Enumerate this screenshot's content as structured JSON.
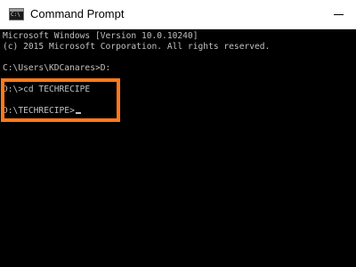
{
  "window": {
    "title": "Command Prompt",
    "icon_label": "C:\\",
    "icons": {
      "app": "command-prompt-icon",
      "minimize": "minimize-icon"
    }
  },
  "console": {
    "lines": [
      "Microsoft Windows [Version 10.0.10240]",
      "(c) 2015 Microsoft Corporation. All rights reserved.",
      "",
      "C:\\Users\\KDCanares>D:",
      "",
      "D:\\>cd TECHRECIPE",
      "",
      "D:\\TECHRECIPE>"
    ]
  },
  "colors": {
    "console_bg": "#000000",
    "console_text": "#c0c0c0",
    "highlight_border": "#ff7a1a",
    "titlebar_bg": "#ffffff"
  }
}
